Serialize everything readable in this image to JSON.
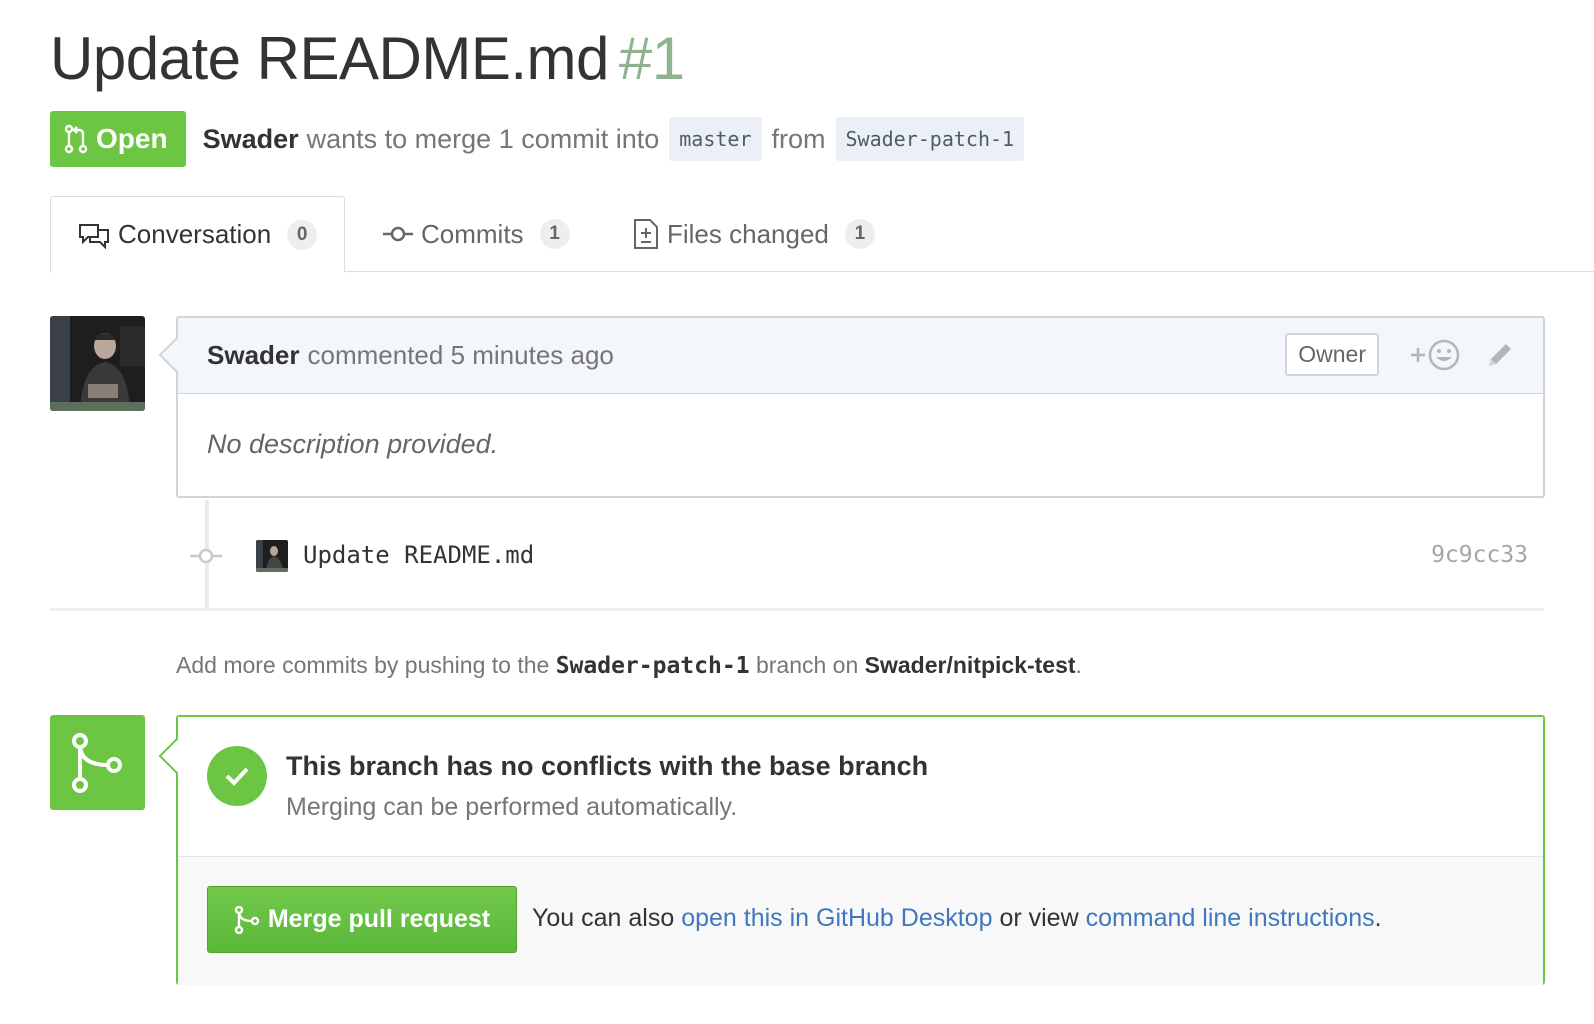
{
  "pr": {
    "title": "Update README.md",
    "number": "#1",
    "state": "Open",
    "author": "Swader",
    "merge_text": "wants to merge 1 commit into",
    "base_branch": "master",
    "from_text": "from",
    "head_branch": "Swader-patch-1"
  },
  "tabs": [
    {
      "label": "Conversation",
      "count": "0",
      "icon": "comment-discussion-icon"
    },
    {
      "label": "Commits",
      "count": "1",
      "icon": "git-commit-icon"
    },
    {
      "label": "Files changed",
      "count": "1",
      "icon": "diff-icon"
    }
  ],
  "comment": {
    "author": "Swader",
    "action": "commented 5 minutes ago",
    "role": "Owner",
    "body": "No description provided."
  },
  "commit": {
    "message": "Update README.md",
    "sha": "9c9cc33"
  },
  "push_hint": {
    "prefix": "Add more commits by pushing to the",
    "branch": "Swader-patch-1",
    "middle": "branch on",
    "repo": "Swader/nitpick-test",
    "suffix": "."
  },
  "merge": {
    "status_title": "This branch has no conflicts with the base branch",
    "status_sub": "Merging can be performed automatically.",
    "button_label": "Merge pull request",
    "also_prefix": "You can also",
    "desktop_link": "open this in GitHub Desktop",
    "or_view": "or view",
    "cli_link": "command line instructions",
    "also_suffix": "."
  },
  "colors": {
    "open_green": "#6cc644",
    "link_blue": "#4078c0",
    "header_bg": "#f3f6fa",
    "number_green": "#8fb38f"
  }
}
